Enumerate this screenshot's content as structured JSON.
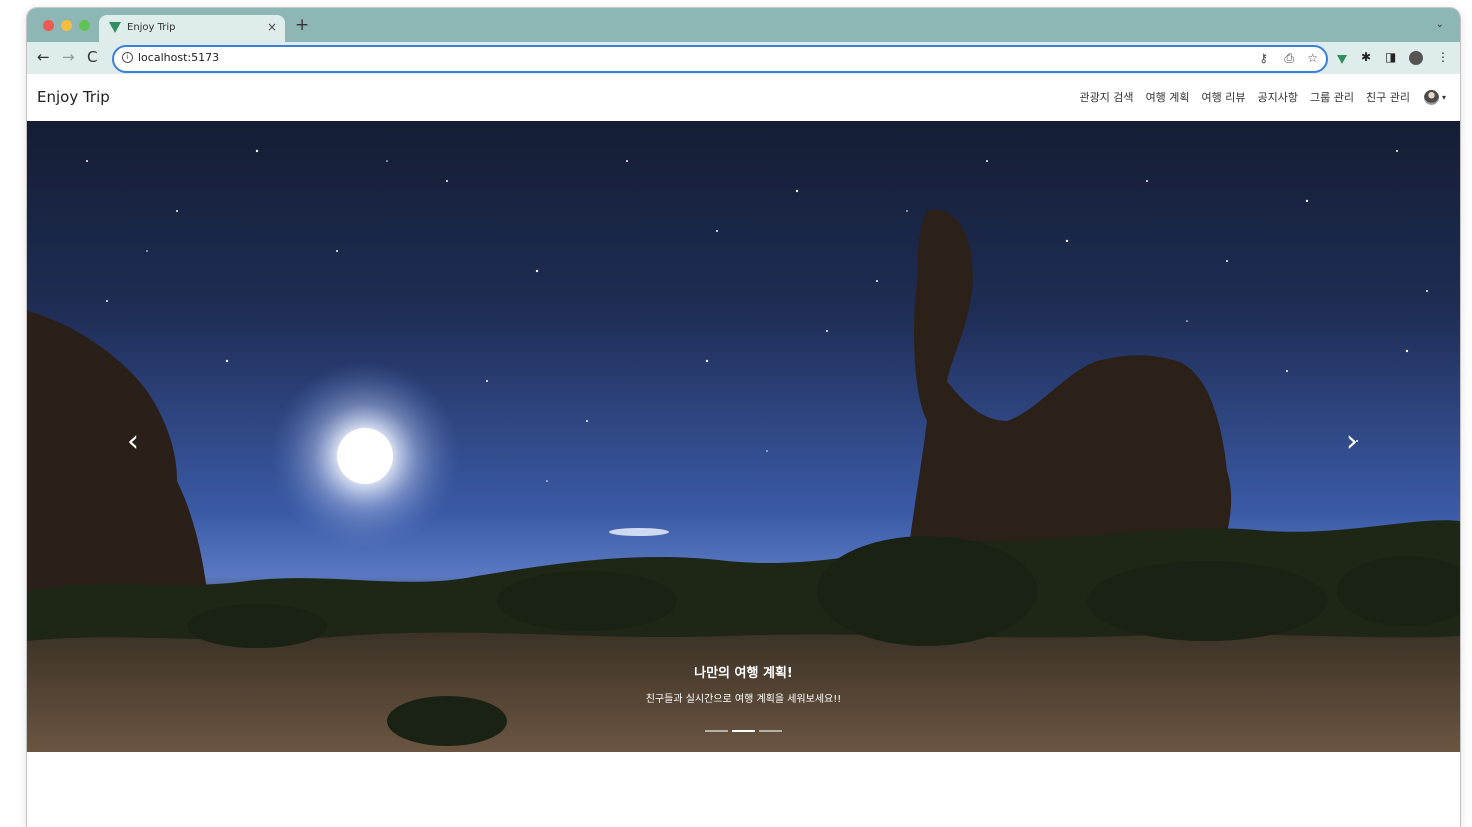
{
  "browser": {
    "tab_title": "Enjoy Trip",
    "tab_close": "×",
    "new_tab": "+",
    "tab_dropdown": "⌄",
    "url": "localhost:5173",
    "icons": {
      "back": "←",
      "forward": "→",
      "reload": "C",
      "info": "i",
      "key": "⚷",
      "share": "⎙",
      "star": "☆",
      "puzzle": "✱",
      "panel": "◨",
      "menu": "⋮"
    }
  },
  "app": {
    "brand": "Enjoy Trip",
    "nav_items": [
      "관광지 검색",
      "여행 계획",
      "여행 리뷰",
      "공지사항",
      "그룹 관리",
      "친구 관리"
    ],
    "avatar_caret": "▾"
  },
  "carousel": {
    "prev": "‹",
    "next": "›",
    "slide_title": "나만의 여행 계획!",
    "slide_text": "친구들과 실시간으로 여행 계획을 세워보세요!!",
    "indicator_count": 3,
    "active_index": 1
  },
  "colors": {
    "tabstrip": "#8eb6b4",
    "toolbar": "#dfecec",
    "omnibox_border": "#3b7fd9"
  }
}
